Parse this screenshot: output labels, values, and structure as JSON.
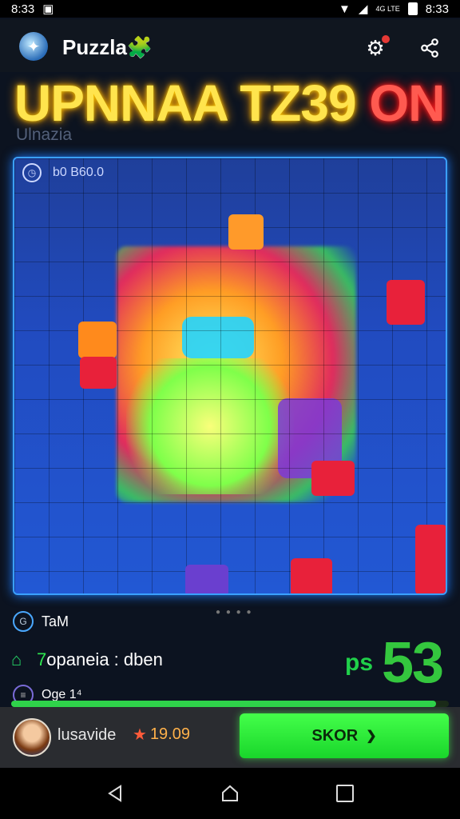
{
  "status_bar": {
    "time_left": "8:33",
    "notif_symbol": "▣",
    "mini_text": "4G\nLTE",
    "time_right": "8:33"
  },
  "header": {
    "app_title": "Puzzla",
    "title_emoji": "🧩",
    "icons": [
      "compass-logo-icon",
      "settings-share-icon",
      "share-icon"
    ]
  },
  "headline": {
    "yellow_text": "UPNNAA TZ39",
    "red_text": "ON",
    "subtitle": "Ulnazia"
  },
  "board": {
    "timer_label": "b0 B60.0"
  },
  "info": {
    "team_label": "TaM",
    "progress_text_green": "7",
    "progress_text_rest": "opaneia : dben",
    "score_prefix": "ps",
    "score_value": "53",
    "stage_label": "Oge 1⁴",
    "progress_fraction": 0.97
  },
  "player": {
    "name": "lusavide",
    "rating": "19.09",
    "cta_label": "SKOR",
    "cta_arrow": "❯"
  },
  "colors": {
    "accent_yellow": "#ffe44d",
    "accent_red": "#ff5a50",
    "accent_green": "#2fd24a",
    "board_blue": "#2258d4"
  }
}
